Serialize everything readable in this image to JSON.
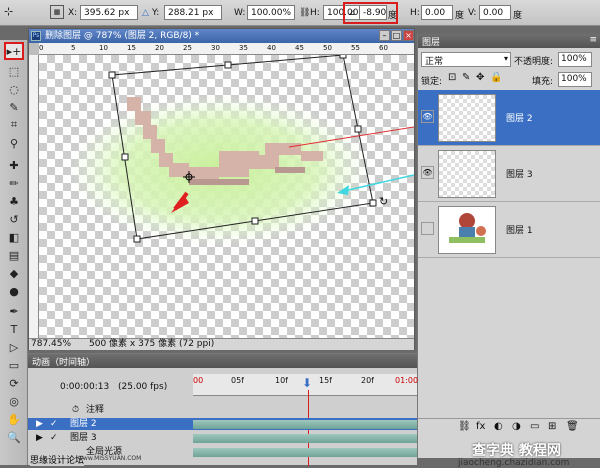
{
  "options_bar": {
    "x_label": "X:",
    "x_value": "395.62 px",
    "y_label": "Y:",
    "y_value": "288.21 px",
    "w_label": "W:",
    "w_value": "100.00%",
    "h_label": "H:",
    "h_value": "100.00%",
    "angle_value": "-8.90",
    "angle_unit": "度",
    "hskew_label": "H:",
    "hskew_value": "0.00",
    "hskew_unit": "度",
    "vskew_label": "V:",
    "vskew_value": "0.00",
    "vskew_unit": "度"
  },
  "document": {
    "title": "删除图层 @ 787% (图层 2, RGB/8) *",
    "ruler_h": [
      "0",
      "5",
      "10",
      "15",
      "20",
      "25",
      "30",
      "35",
      "40",
      "45",
      "50",
      "55",
      "60"
    ],
    "zoom": "787.45%",
    "doc_size": "500 像素 x 375 像素 (72 ppi)"
  },
  "layers_panel": {
    "title": "图层",
    "blend_mode": "正常",
    "opacity_label": "不透明度:",
    "opacity_value": "100%",
    "lock_label": "锁定:",
    "fill_label": "填充:",
    "fill_value": "100%",
    "layers": [
      {
        "name": "图层 2",
        "selected": true
      },
      {
        "name": "图层 3",
        "selected": false
      },
      {
        "name": "图层 1",
        "selected": false
      }
    ]
  },
  "timeline": {
    "tab_label": "动画（时间轴）",
    "timecode": "0:00:00:13",
    "fps": "(25.00 fps)",
    "ticks": [
      "00",
      "05f",
      "10f",
      "15f",
      "20f",
      "01:00"
    ],
    "rows": [
      "注释",
      "图层 2",
      "图层 3",
      "全局光源"
    ]
  },
  "watermark_left": "思缘设计论坛",
  "watermark_site_left": "www.MISSYUAN.COM",
  "watermark_right": "查字典 教程网",
  "watermark_url": "jiaocheng.chazidian.com",
  "colors": {
    "selection_blue": "#3a6fc4",
    "annotation_red": "#e02020",
    "annotation_cyan": "#40d8e0"
  }
}
